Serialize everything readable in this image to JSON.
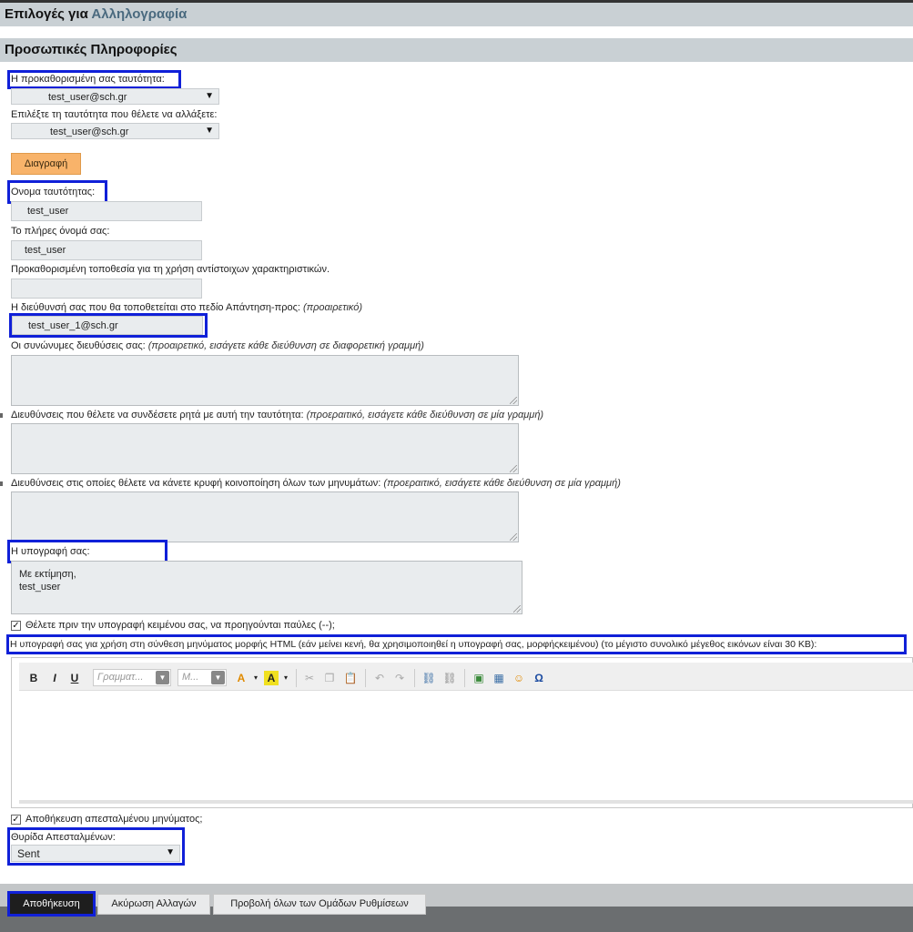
{
  "header": {
    "prefix": "Επιλογές για",
    "app": "Αλληλογραφία"
  },
  "section": {
    "title": "Προσωπικές Πληροφορίες"
  },
  "identity": {
    "default_label": "Η προκαθορισμένη σας ταυτότητα:",
    "default_value": "test_user@sch.gr",
    "change_label": "Επιλέξτε τη ταυτότητα που θέλετε να αλλάξετε:",
    "change_value": "test_user@sch.gr",
    "delete_label": "Διαγραφή"
  },
  "fields": {
    "identity_name_label": "Ονομα ταυτότητας:",
    "identity_name_value": "test_user",
    "full_name_label": "Το πλήρες όνομά σας:",
    "full_name_value": "test_user",
    "location_label": "Προκαθορισμένη τοποθεσία για τη χρήση αντίστοιχων χαρακτηριστικών.",
    "location_value": "",
    "replyto_label": "Η διεύθυνσή σας που θα τοποθετείται στο πεδίο Απάντηση-προς:",
    "replyto_hint": "(προαιρετικό)",
    "replyto_value": "test_user_1@sch.gr",
    "alias_label": "Οι συνώνυμες διευθύσεις σας:",
    "alias_hint": "(προαιρετικό, εισάγετε κάθε διεύθυνση σε διαφορετική γραμμή)",
    "tie_label": "Διευθύνσεις που θέλετε να συνδέσετε ρητά με αυτή την ταυτότητα:",
    "tie_hint": "(προεραιτικό, εισάγετε κάθε διεύθυνση σε μία γραμμή)",
    "bcc_label": "Διευθύνσεις στις οποίες θέλετε να κάνετε κρυφή κοινοποίηση όλων των μηνυμάτων:",
    "bcc_hint": "(προεραιτικό, εισάγετε κάθε διεύθυνση σε μία γραμμή)",
    "signature_label": "Η υπογραφή σας:",
    "signature_line1": "Με εκτίμηση,",
    "signature_line2": "test_user",
    "dashes_label": "Θέλετε πριν την υπογραφή κειμένου σας, να προηγούνται παύλες (--);",
    "html_sig_label": "Η υπογραφή σας για χρήση στη σύνθεση μηνύματος μορφής HTML (εάν μείνει κενή, θα χρησιμοποιηθεί η υπογραφή σας, μορφήςκειμένου) (το μέγιστο συνολικό μέγεθος εικόνων είναι 30 KB):",
    "save_sent_label": "Αποθήκευση απεσταλμένου μηνύματος;",
    "sent_folder_label": "Θυρίδα Απεσταλμένων:",
    "sent_folder_value": "Sent"
  },
  "editor": {
    "bold": "B",
    "italic": "I",
    "underline": "U",
    "font_placeholder": "Γραμματ...",
    "size_placeholder": "Μ..."
  },
  "footer": {
    "save": "Αποθήκευση",
    "undo": "Ακύρωση Αλλαγών",
    "show_all": "Προβολή όλων των Ομάδων Ρυθμίσεων"
  },
  "colors": {
    "highlight": "#1020d8",
    "delete_button": "#f8b36a",
    "header_bg": "#c9d0d4"
  }
}
